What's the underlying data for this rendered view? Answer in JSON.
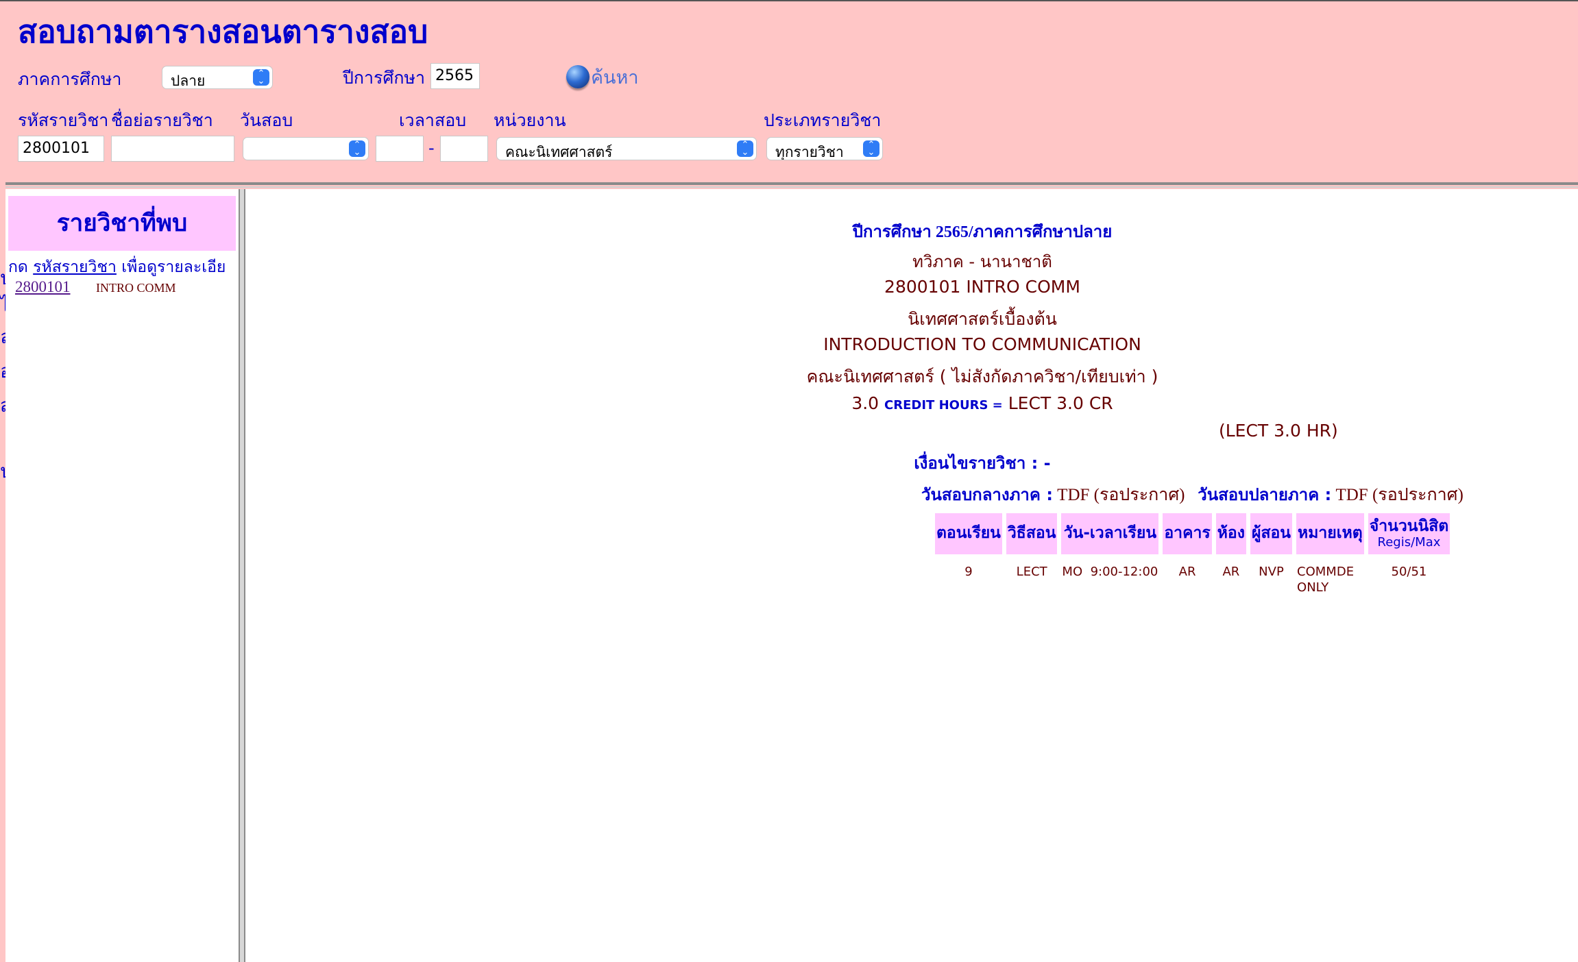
{
  "page": {
    "title": "สอบถามตารางสอนตารางสอบ"
  },
  "form": {
    "semester_label": "ภาคการศึกษา",
    "semester_value": "ปลาย",
    "year_label": "ปีการศึกษา",
    "year_value": "2565",
    "search_label": "ค้นหา",
    "course_code_label": "รหัสรายวิชา",
    "course_code_value": "2800101",
    "course_abbr_label": "ชื่อย่อรายวิชา",
    "course_abbr_value": "",
    "exam_date_label": "วันสอบ",
    "exam_date_value": "",
    "exam_time_label": "เวลาสอบ",
    "exam_time_from": "",
    "exam_time_separator": "-",
    "exam_time_to": "",
    "department_label": "หน่วยงาน",
    "department_value": "คณะนิเทศศาสตร์",
    "course_type_label": "ประเภทรายวิชา",
    "course_type_value": "ทุกรายวิชา"
  },
  "sidebar": {
    "header": "รายวิชาที่พบ",
    "instruction_prefix": "กด",
    "instruction_link": "รหัสรายวิชา",
    "instruction_suffix": "เพื่อดูรายละเอีย",
    "results": [
      {
        "code": "2800101",
        "abbr": "INTRO COMM"
      }
    ]
  },
  "detail": {
    "term_heading": "ปีการศึกษา 2565/ภาคการศึกษาปลาย",
    "program": "ทวิภาค - นานาชาติ",
    "code_and_abbr": "2800101  INTRO COMM",
    "name_th": "นิเทศศาสตร์เบื้องต้น",
    "name_en": "INTRODUCTION TO COMMUNICATION",
    "faculty": "คณะนิเทศศาสตร์ ( ไม่สังกัดภาควิชา/เทียบเท่า )",
    "credits": "3.0",
    "credit_label": "CREDIT HOURS =",
    "credit_detail": "LECT 3.0 CR",
    "hour_detail": "(LECT 3.0 HR)",
    "condition": "เงื่อนไขรายวิชา : -",
    "midterm_label": "วันสอบกลางภาค :",
    "midterm_value": "TDF (รอประกาศ)",
    "final_label": "วันสอบปลายภาค :",
    "final_value": "TDF  (รอประกาศ)"
  },
  "sections_table": {
    "headers": [
      "ตอนเรียน",
      "วิธีสอน",
      "วัน-เวลาเรียน",
      "อาคาร",
      "ห้อง",
      "ผู้สอน",
      "หมายเหตุ",
      "จำนวนนิสิต"
    ],
    "seats_subheader": "Regis/Max",
    "rows": [
      {
        "section": "9",
        "method": "LECT",
        "day_time": "MO  9:00-12:00",
        "building": "AR",
        "room": "AR",
        "instructor": "NVP",
        "note": "COMMDE ONLY",
        "seats": "50/51"
      }
    ]
  },
  "colors": {
    "background": "#ffc6c6",
    "header_cell": "#ffc6ff",
    "label_blue": "#0000cc",
    "maroon_text": "#660000",
    "visited_link": "#551a8b"
  }
}
